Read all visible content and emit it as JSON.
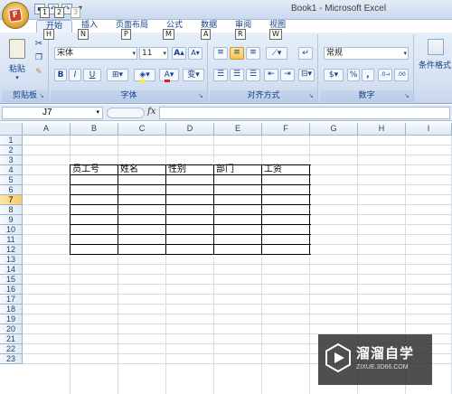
{
  "app": {
    "title": "Book1 - Microsoft Excel"
  },
  "quick_access": {
    "keytips": [
      "1",
      "2",
      "3"
    ]
  },
  "tabs": [
    {
      "label": "开始",
      "keytip": "H"
    },
    {
      "label": "插入",
      "keytip": "N"
    },
    {
      "label": "页面布局",
      "keytip": "P"
    },
    {
      "label": "公式",
      "keytip": "M"
    },
    {
      "label": "数据",
      "keytip": "A"
    },
    {
      "label": "审阅",
      "keytip": "R"
    },
    {
      "label": "视图",
      "keytip": "W"
    }
  ],
  "ribbon": {
    "clipboard": {
      "label": "剪贴板",
      "paste_label": "粘贴"
    },
    "font": {
      "label": "字体",
      "font_name": "宋体",
      "font_size": "11",
      "grow": "A",
      "shrink": "A",
      "bold": "B",
      "italic": "I",
      "underline": "U",
      "font_color_glyph": "A",
      "phonetic": "变"
    },
    "alignment": {
      "label": "对齐方式"
    },
    "number": {
      "label": "数字",
      "format": "常规",
      "percent": "%",
      "comma": ","
    },
    "styles": {
      "conditional_format": "条件格式"
    }
  },
  "formula_bar": {
    "name_box": "J7",
    "fx": "fx",
    "formula": ""
  },
  "sheet": {
    "columns": [
      "A",
      "B",
      "C",
      "D",
      "E",
      "F",
      "G",
      "H",
      "I"
    ],
    "rows": [
      "1",
      "2",
      "3",
      "4",
      "5",
      "6",
      "7",
      "8",
      "9",
      "10",
      "11",
      "12",
      "13",
      "14",
      "15",
      "16",
      "17",
      "18",
      "19",
      "20",
      "21",
      "22",
      "23"
    ],
    "active_row": "7",
    "headers": [
      "员工号",
      "姓名",
      "性别",
      "部门",
      "工资"
    ]
  },
  "watermark": {
    "title": "溜溜自学",
    "subtitle": "ZIXUE.3D66.COM"
  },
  "colors": {
    "ribbon_bg": "#d5e1f2",
    "accent": "#15428b",
    "active_header": "#f8c96a",
    "grid_line": "#d4dce6"
  }
}
